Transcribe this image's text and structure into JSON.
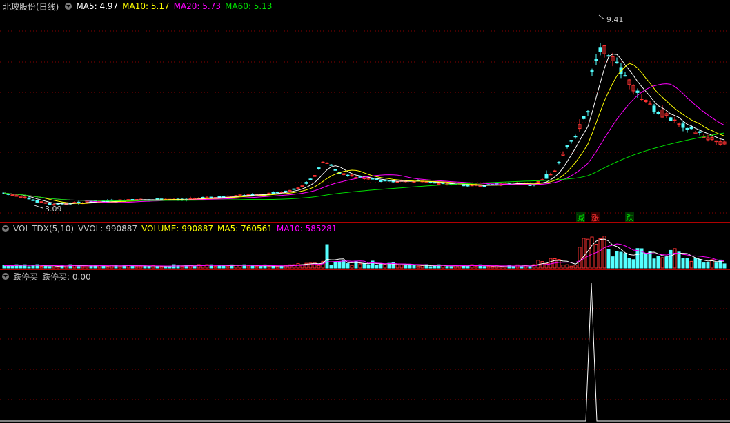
{
  "colors": {
    "up": "#ff3232",
    "down": "#54ffff",
    "ma5": "#ffffff",
    "ma10": "#ffff00",
    "ma20": "#ff00ff",
    "ma60": "#00e000",
    "grid": "#8a0000"
  },
  "main": {
    "stock_name": "北玻股份(日线)",
    "ma5_label": "MA5:",
    "ma5_value": "4.97",
    "ma10_label": "MA10:",
    "ma10_value": "5.17",
    "ma20_label": "MA20:",
    "ma20_value": "5.73",
    "ma60_label": "MA60:",
    "ma60_value": "5.13",
    "high_label": "9.41",
    "low_label": "3.09",
    "markers": [
      "减",
      "涨",
      "跌"
    ]
  },
  "volume": {
    "indicator": "VOL-TDX(5,10)",
    "vvol_label": "VVOL:",
    "vvol_value": "990887",
    "volume_label": "VOLUME:",
    "volume_value": "990887",
    "ma5_label": "MA5:",
    "ma5_value": "760561",
    "ma10_label": "MA10:",
    "ma10_value": "585281"
  },
  "signal": {
    "indicator": "跌停买",
    "value_label": "跌停买:",
    "value": "0.00",
    "spike_value": 1
  }
}
